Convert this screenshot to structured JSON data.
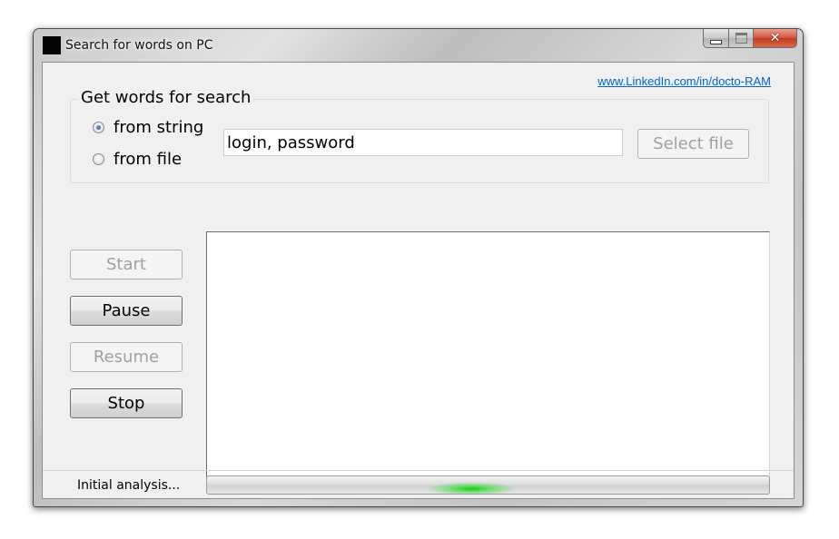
{
  "window": {
    "title": "Search for words on PC",
    "close_glyph": "✕"
  },
  "link": {
    "text": "www.LinkedIn.com/in/docto-RAM"
  },
  "group": {
    "legend": "Get words for search",
    "radio_string_label": "from string",
    "radio_file_label": "from file",
    "selected": "from string",
    "input_value": "login, password",
    "select_file_label": "Select file"
  },
  "controls": {
    "start_label": "Start",
    "pause_label": "Pause",
    "resume_label": "Resume",
    "stop_label": "Stop"
  },
  "status": {
    "text": "Initial analysis...",
    "progress_mode": "marquee",
    "marquee_position_fraction": 0.39
  },
  "colors": {
    "link": "#0066cc",
    "progress_glow": "#0fd20f",
    "close_button": "#c23a20"
  },
  "icons": {
    "app_icon": "black-square-icon",
    "minimize": "minimize-icon",
    "maximize": "maximize-icon",
    "close": "close-icon"
  }
}
